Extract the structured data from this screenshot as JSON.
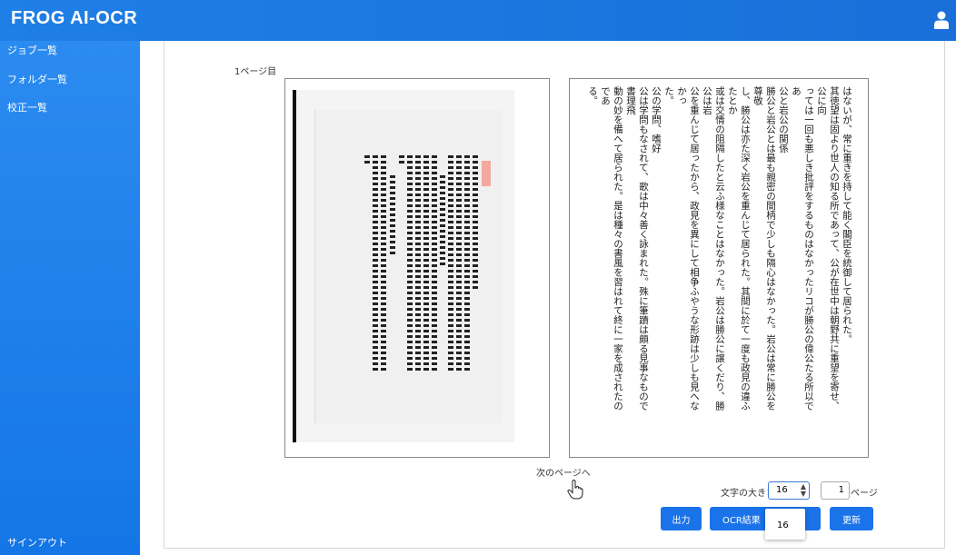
{
  "app": {
    "title": "FROG AI-OCR"
  },
  "sidebar": {
    "items": [
      {
        "label": "ジョブ一覧"
      },
      {
        "label": "フォルダ一覧"
      },
      {
        "label": "校正一覧"
      }
    ],
    "signout_label": "サインアウト"
  },
  "viewer": {
    "page_label": "1ページ目",
    "ocr_lines": [
      "はないが、常に重きを持して能く閣臣を統御して居られた。",
      "其徳望は固より世人の知る所であって、公が在世中は朝野共に重望を寄せ、公に向",
      "っては一回も悪しき批評をするものはなかったリコが勝公の偉公たる所以であ",
      "公と岩公の関係",
      "勝公と岩公とは最も親密の間柄で少しも隔心はなかった。岩公は常に勝公を尊敬",
      "し、勝公は亦た深く岩公を重んじて居られた。其間に於て一度も政見の違ふたとか",
      "或は交情の阻隔したと云ふ様なことはなかった。岩公は勝公に譲くだり、勝公は岩",
      "公を重んじて居ったから、政見を異にして相争ふやうな形跡は少しも見へなかっ",
      "た。",
      "公の学問、嗜好",
      "公は学問もなされて、歌は中々善く詠まれた。殊に筆蹟は頗る見事なもので書理飛",
      "動の妙を備へて居られた。是は種々の書風を習はれて終に一家を成されたのであ",
      "る。"
    ],
    "next_page_label": "次のページへ"
  },
  "controls": {
    "font_size_label": "文字の大きさ",
    "font_size_value": "16",
    "font_size_option": "16",
    "page_number": "1",
    "page_suffix": "ページ",
    "export_label": "出力",
    "ocr_result_label": "OCR結果",
    "update_label": "更新"
  }
}
